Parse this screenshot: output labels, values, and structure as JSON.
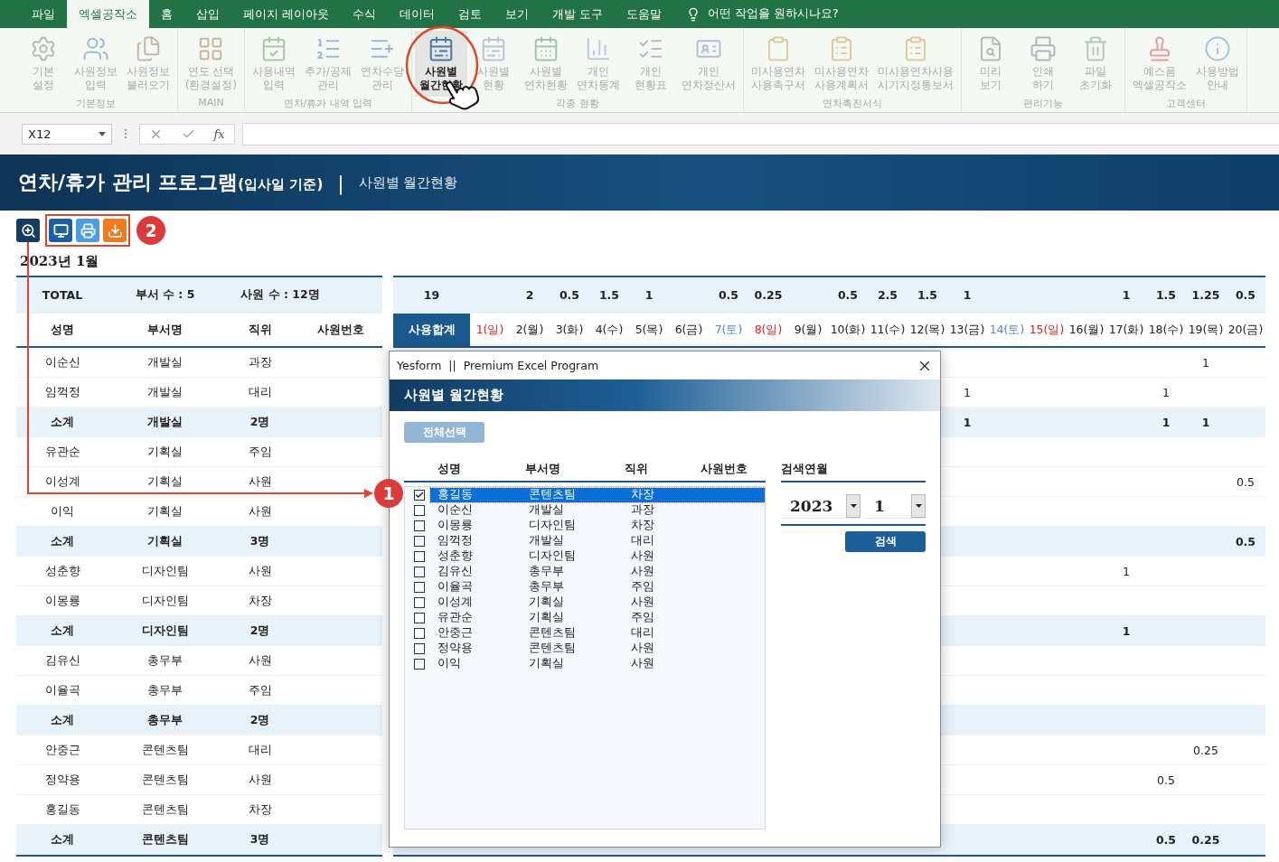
{
  "tabs": [
    {
      "label": "파일",
      "selected": false
    },
    {
      "label": "엑셀공작소",
      "selected": true
    },
    {
      "label": "홈",
      "selected": false
    },
    {
      "label": "삽입",
      "selected": false
    },
    {
      "label": "페이지 레이아웃",
      "selected": false
    },
    {
      "label": "수식",
      "selected": false
    },
    {
      "label": "데이터",
      "selected": false
    },
    {
      "label": "검토",
      "selected": false
    },
    {
      "label": "보기",
      "selected": false
    },
    {
      "label": "개발 도구",
      "selected": false
    },
    {
      "label": "도움말",
      "selected": false
    }
  ],
  "tell_me": "어떤 작업을 원하시나요?",
  "ribbon_groups": [
    {
      "label": "기본정보",
      "buttons": [
        {
          "lines": [
            "기본",
            "설정"
          ],
          "disabled": true,
          "selected": false
        },
        {
          "lines": [
            "사원정보",
            "입력"
          ],
          "disabled": true,
          "selected": false
        },
        {
          "lines": [
            "사원정보",
            "불러오기"
          ],
          "disabled": true,
          "selected": false
        }
      ]
    },
    {
      "label": "MAIN",
      "buttons": [
        {
          "lines": [
            "연도 선택",
            "(환경설정)"
          ],
          "disabled": true,
          "selected": false
        }
      ]
    },
    {
      "label": "연차/휴가 내역 입력",
      "buttons": [
        {
          "lines": [
            "사용내역",
            "입력"
          ],
          "disabled": true,
          "selected": false
        },
        {
          "lines": [
            "추가/공제",
            "관리"
          ],
          "disabled": true,
          "selected": false
        },
        {
          "lines": [
            "연차수당",
            "관리"
          ],
          "disabled": true,
          "selected": false
        }
      ]
    },
    {
      "label": "각종 현황",
      "buttons": [
        {
          "lines": [
            "사원별",
            "월간현황"
          ],
          "disabled": false,
          "selected": true
        },
        {
          "lines": [
            "사원별",
            "현황"
          ],
          "disabled": true,
          "selected": false
        },
        {
          "lines": [
            "사원별",
            "연차현황"
          ],
          "disabled": true,
          "selected": false
        },
        {
          "lines": [
            "개인",
            "연차통계"
          ],
          "disabled": true,
          "selected": false
        },
        {
          "lines": [
            "개인",
            "현황표"
          ],
          "disabled": true,
          "selected": false
        },
        {
          "lines": [
            "개인",
            "연차정산서"
          ],
          "disabled": true,
          "selected": false
        }
      ]
    },
    {
      "label": "연차촉진서식",
      "buttons": [
        {
          "lines": [
            "미사용연차",
            "사용촉구서"
          ],
          "disabled": true,
          "selected": false
        },
        {
          "lines": [
            "미사용연차",
            "사용계획서"
          ],
          "disabled": true,
          "selected": false
        },
        {
          "lines": [
            "미사용연차사용",
            "시기지정통보서"
          ],
          "disabled": true,
          "selected": false
        }
      ]
    },
    {
      "label": "편리기능",
      "buttons": [
        {
          "lines": [
            "미리",
            "보기"
          ],
          "disabled": true,
          "selected": false
        },
        {
          "lines": [
            "인쇄",
            "하기"
          ],
          "disabled": true,
          "selected": false
        },
        {
          "lines": [
            "파일",
            "초기화"
          ],
          "disabled": true,
          "selected": false
        }
      ]
    },
    {
      "label": "고객센터",
      "buttons": [
        {
          "lines": [
            "예스폼",
            "엑셀공작소"
          ],
          "disabled": true,
          "selected": false
        },
        {
          "lines": [
            "사용방법",
            "안내"
          ],
          "disabled": true,
          "selected": false
        }
      ]
    }
  ],
  "formula_bar": {
    "name_box": "X12",
    "function_label": "fx"
  },
  "banner": {
    "title": "연차/휴가 관리 프로그램",
    "title_note": "(입사일 기준)",
    "separator": "|",
    "subtitle": "사원별 월간현황"
  },
  "toolbar": [
    {
      "color": "#173c62"
    },
    {
      "color": "#1e5f9e"
    },
    {
      "color": "#4b9ee0"
    },
    {
      "color": "#f07a1e"
    }
  ],
  "callouts": [
    {
      "label": "1"
    },
    {
      "label": "2"
    }
  ],
  "month_title": "2023년 1월",
  "summary": {
    "total": "TOTAL",
    "departments": "부서 수 : 5",
    "employees": "사원 수 : 12명",
    "grand_total": "19",
    "day_totals": {
      "day_2": "2",
      "day_3": "0.5",
      "day_4": "1.5",
      "day_5": "1",
      "day_7": "0.5",
      "day_8": "0.25",
      "day_10": "0.5",
      "day_11": "2.5",
      "day_12": "1.5",
      "day_13": "1",
      "day_17": "1",
      "day_18": "1.5",
      "day_19": "1.25",
      "day_20": "0.5"
    }
  },
  "columns": [
    "성명",
    "부서명",
    "직위",
    "사원번호"
  ],
  "sum_header": "사용합계",
  "days": [
    {
      "label": "1(일)",
      "kind": "sunday"
    },
    {
      "label": "2(월)",
      "kind": "weekday"
    },
    {
      "label": "3(화)",
      "kind": "weekday"
    },
    {
      "label": "4(수)",
      "kind": "weekday"
    },
    {
      "label": "5(목)",
      "kind": "weekday"
    },
    {
      "label": "6(금)",
      "kind": "weekday"
    },
    {
      "label": "7(토)",
      "kind": "saturday"
    },
    {
      "label": "8(일)",
      "kind": "sunday"
    },
    {
      "label": "9(월)",
      "kind": "weekday"
    },
    {
      "label": "10(화)",
      "kind": "weekday"
    },
    {
      "label": "11(수)",
      "kind": "weekday"
    },
    {
      "label": "12(목)",
      "kind": "weekday"
    },
    {
      "label": "13(금)",
      "kind": "weekday"
    },
    {
      "label": "14(토)",
      "kind": "saturday"
    },
    {
      "label": "15(일)",
      "kind": "sunday"
    },
    {
      "label": "16(월)",
      "kind": "weekday"
    },
    {
      "label": "17(화)",
      "kind": "weekday"
    },
    {
      "label": "18(수)",
      "kind": "weekday"
    },
    {
      "label": "19(목)",
      "kind": "weekday"
    },
    {
      "label": "20(금)",
      "kind": "weekday"
    }
  ],
  "rows": [
    {
      "kind": "person",
      "name": "이순신",
      "dept": "개발실",
      "position": "과장",
      "days": {
        "day_19": "1"
      }
    },
    {
      "kind": "person",
      "name": "임꺽정",
      "dept": "개발실",
      "position": "대리",
      "days": {
        "day_13": "1",
        "day_18": "1"
      }
    },
    {
      "kind": "subtotal",
      "name": "소계",
      "dept": "개발실",
      "position": "2명",
      "days": {
        "day_13": "1",
        "day_18": "1",
        "day_19": "1"
      }
    },
    {
      "kind": "person",
      "name": "유관순",
      "dept": "기획실",
      "position": "주임"
    },
    {
      "kind": "person",
      "name": "이성계",
      "dept": "기획실",
      "position": "사원",
      "days": {
        "day_20": "0.5"
      }
    },
    {
      "kind": "person",
      "name": "이익",
      "dept": "기획실",
      "position": "사원"
    },
    {
      "kind": "subtotal",
      "name": "소계",
      "dept": "기획실",
      "position": "3명",
      "days": {
        "day_20": "0.5"
      }
    },
    {
      "kind": "person",
      "name": "성춘향",
      "dept": "디자인팀",
      "position": "사원",
      "days": {
        "day_17": "1"
      }
    },
    {
      "kind": "person",
      "name": "이몽룡",
      "dept": "디자인팀",
      "position": "차장"
    },
    {
      "kind": "subtotal",
      "name": "소계",
      "dept": "디자인팀",
      "position": "2명",
      "days": {
        "day_17": "1"
      }
    },
    {
      "kind": "person",
      "name": "김유신",
      "dept": "총무부",
      "position": "사원"
    },
    {
      "kind": "person",
      "name": "이율곡",
      "dept": "총무부",
      "position": "주임"
    },
    {
      "kind": "subtotal",
      "name": "소계",
      "dept": "총무부",
      "position": "2명"
    },
    {
      "kind": "person",
      "name": "안중근",
      "dept": "콘텐츠팀",
      "position": "대리",
      "days": {
        "day_19": "0.25"
      }
    },
    {
      "kind": "person",
      "name": "정약용",
      "dept": "콘텐츠팀",
      "position": "사원",
      "days": {
        "day_18": "0.5"
      }
    },
    {
      "kind": "person",
      "name": "홍길동",
      "dept": "콘텐츠팀",
      "position": "차장"
    },
    {
      "kind": "subtotal",
      "name": "소계",
      "dept": "콘텐츠팀",
      "position": "3명",
      "days": {
        "day_18": "0.5",
        "day_19": "0.25"
      }
    }
  ],
  "dialog": {
    "title": "Yesform  ||  Premium Excel Program",
    "heading": "사원별 월간현황",
    "select_all": "전체선택",
    "columns": [
      "성명",
      "부서명",
      "직위",
      "사원번호"
    ],
    "items": [
      {
        "name": "홍길동",
        "dept": "콘텐츠팀",
        "position": "차장",
        "checked": true,
        "selected": true
      },
      {
        "name": "이순신",
        "dept": "개발실",
        "position": "과장",
        "checked": false,
        "selected": false
      },
      {
        "name": "이몽룡",
        "dept": "디자인팀",
        "position": "차장",
        "checked": false,
        "selected": false
      },
      {
        "name": "임꺽정",
        "dept": "개발실",
        "position": "대리",
        "checked": false,
        "selected": false
      },
      {
        "name": "성춘향",
        "dept": "디자인팀",
        "position": "사원",
        "checked": false,
        "selected": false
      },
      {
        "name": "김유신",
        "dept": "총무부",
        "position": "사원",
        "checked": false,
        "selected": false
      },
      {
        "name": "이율곡",
        "dept": "총무부",
        "position": "주임",
        "checked": false,
        "selected": false
      },
      {
        "name": "이성계",
        "dept": "기획실",
        "position": "사원",
        "checked": false,
        "selected": false
      },
      {
        "name": "유관순",
        "dept": "기획실",
        "position": "주임",
        "checked": false,
        "selected": false
      },
      {
        "name": "안중근",
        "dept": "콘텐츠팀",
        "position": "대리",
        "checked": false,
        "selected": false
      },
      {
        "name": "정약용",
        "dept": "콘텐츠팀",
        "position": "사원",
        "checked": false,
        "selected": false
      },
      {
        "name": "이익",
        "dept": "기획실",
        "position": "사원",
        "checked": false,
        "selected": false
      }
    ],
    "search_label": "검색연월",
    "year": "2023",
    "month": "1",
    "search_button": "검색"
  }
}
